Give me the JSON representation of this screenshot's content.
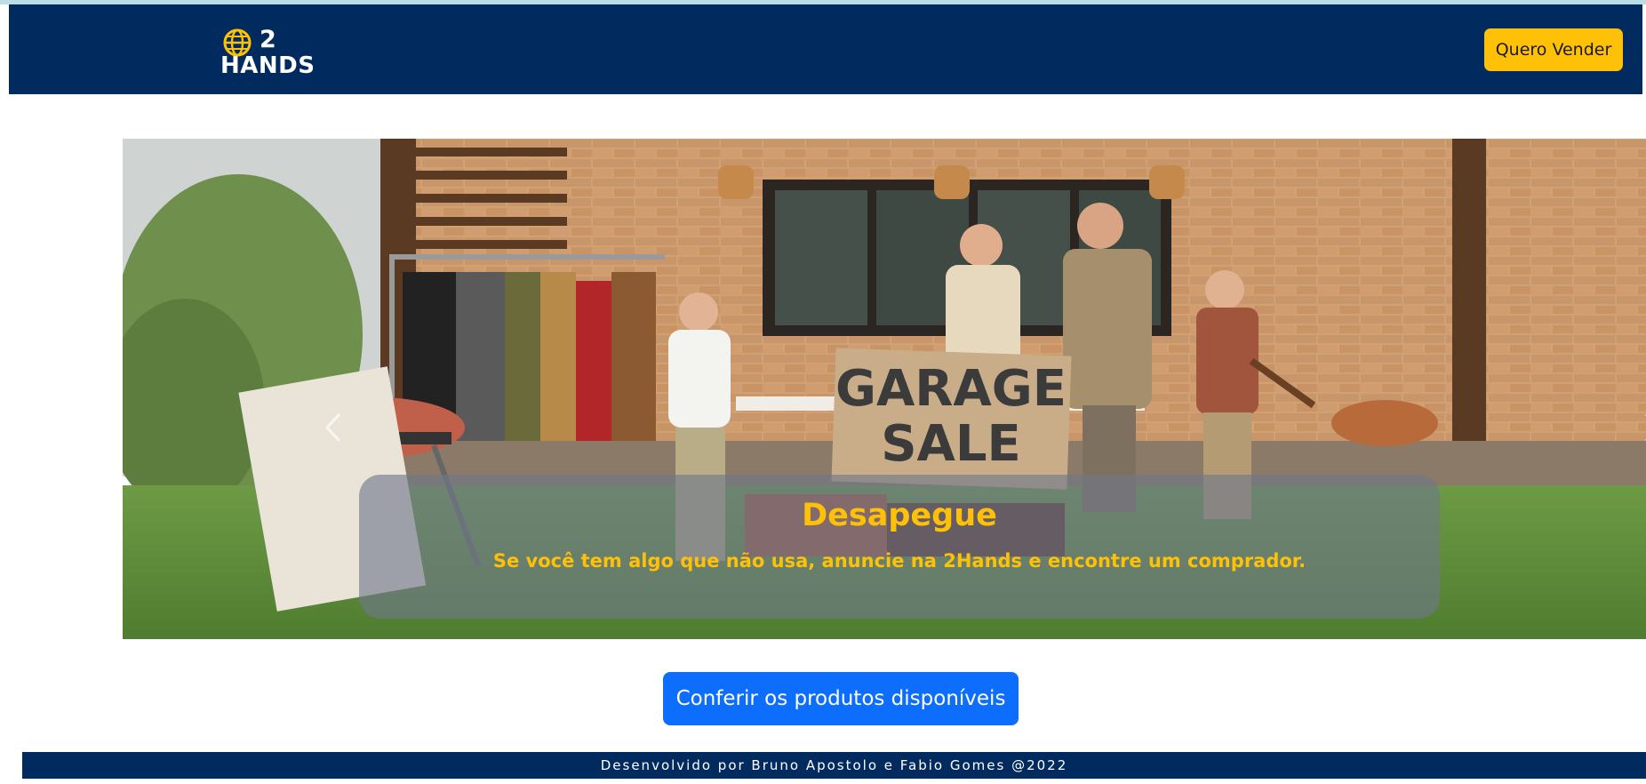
{
  "colors": {
    "navbar_bg": "#012a5e",
    "accent_yellow": "#ffc107",
    "primary_blue": "#0d6efd",
    "top_strip": "#b9dfe5"
  },
  "header": {
    "logo": {
      "icon": "globe-icon",
      "line1": "2",
      "line2": "HANDS"
    },
    "sell_button_label": "Quero Vender"
  },
  "carousel": {
    "image": "garage-sale-family-photo",
    "sign_text": [
      "GARAGE",
      "SALE"
    ],
    "prev_icon": "chevron-left-icon",
    "next_icon": "chevron-right-icon",
    "caption": {
      "title": "Desapegue",
      "text": "Se você tem algo que não usa, anuncie na 2Hands e encontre um comprador."
    }
  },
  "cta_label": "Conferir os produtos disponíveis",
  "footer_text": "Desenvolvido por Bruno Apostolo e Fabio Gomes @2022"
}
